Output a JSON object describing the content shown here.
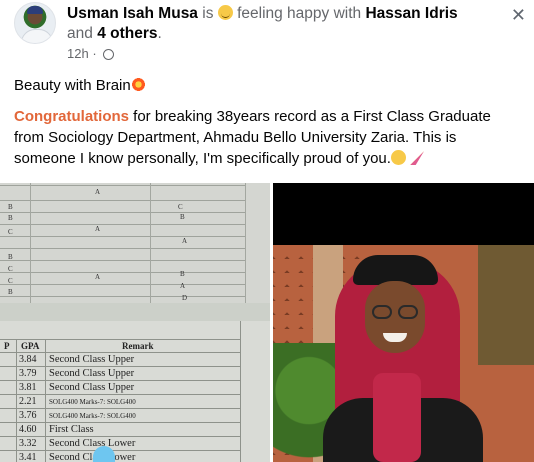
{
  "post": {
    "author": "Usman Isah Musa",
    "feeling_prefix": "is",
    "feeling": "feeling happy with",
    "tagged": "Hassan Idris",
    "and": "and",
    "others": "4 others",
    "period": ".",
    "time": "12h",
    "time_sep": "·",
    "close_label": "✕"
  },
  "body": {
    "line1": "Beauty with Brain",
    "congrats": "Congratulations",
    "message": " for breaking 38years record as a First Class Graduate from Sociology Department, Ahmadu Bello University Zaria. This is someone I know personally, I'm specifically proud of you."
  },
  "result_sheet": {
    "col_p": "P",
    "col_gpa": "GPA",
    "col_remark": "Remark",
    "rows": [
      {
        "gpa": "3.84",
        "remark": "Second Class Upper"
      },
      {
        "gpa": "3.79",
        "remark": "Second Class Upper"
      },
      {
        "gpa": "3.81",
        "remark": "Second Class Upper"
      },
      {
        "gpa": "2.21",
        "remark": "SOLG400 Marks-7: SOLG400"
      },
      {
        "gpa": "3.76",
        "remark": "SOLG400 Marks-7: SOLG400"
      },
      {
        "gpa": "4.60",
        "remark": "First Class"
      },
      {
        "gpa": "3.32",
        "remark": "Second Class Lower"
      },
      {
        "gpa": "3.41",
        "remark": "Second Class Lower"
      }
    ],
    "grades_top": [
      "A",
      "B",
      "C",
      "B",
      "B",
      "A",
      "A",
      "C",
      "B",
      "A",
      "B",
      "C",
      "A",
      "B",
      "C",
      "D"
    ]
  },
  "icons": {
    "avatar": "profile-avatar",
    "feeling": "smiley-emoji",
    "privacy": "globe-icon",
    "close": "close-icon"
  },
  "colors": {
    "congrats": "#e2673a",
    "meta": "#65676b",
    "text": "#050505"
  }
}
